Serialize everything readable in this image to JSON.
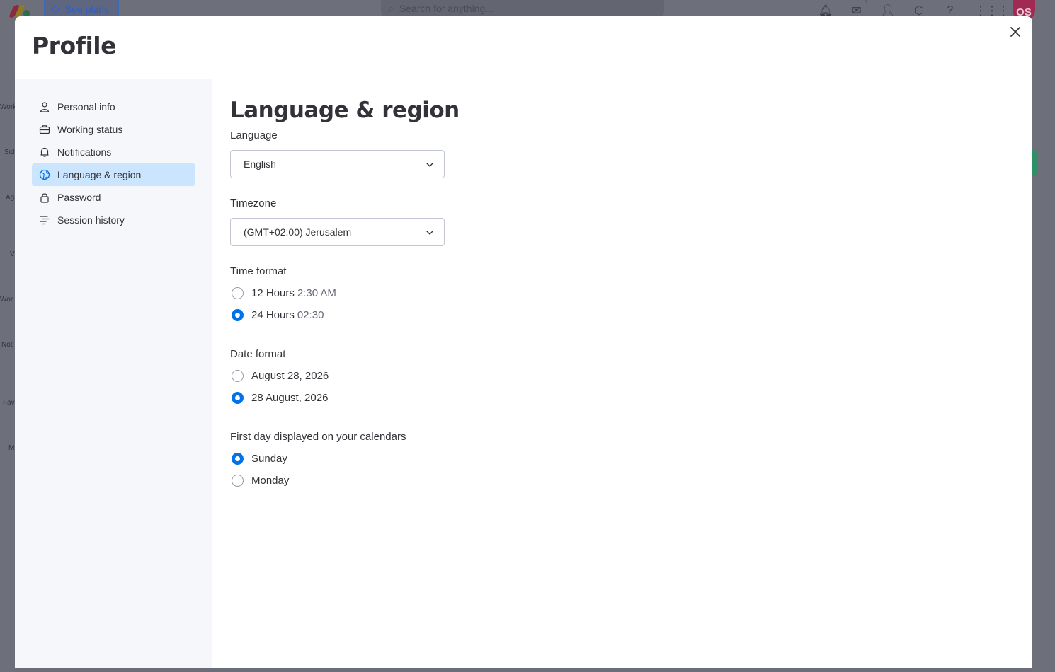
{
  "background": {
    "see_plans": "See plans",
    "search_placeholder": "Search for anything...",
    "inbox_count": "1",
    "avatar_initials": "OS",
    "left_labels": [
      "Work",
      "Sid",
      "Ag",
      "V",
      "Wor",
      "Not",
      "Fav",
      "M"
    ]
  },
  "modal": {
    "title": "Profile",
    "close_icon": "close-icon"
  },
  "sidebar": {
    "items": [
      {
        "label": "Personal info",
        "icon": "person-icon"
      },
      {
        "label": "Working status",
        "icon": "briefcase-icon"
      },
      {
        "label": "Notifications",
        "icon": "bell-icon"
      },
      {
        "label": "Language & region",
        "icon": "globe-icon",
        "active": true
      },
      {
        "label": "Password",
        "icon": "lock-icon"
      },
      {
        "label": "Session history",
        "icon": "list-icon"
      }
    ]
  },
  "content": {
    "title": "Language & region",
    "language": {
      "label": "Language",
      "value": "English"
    },
    "timezone": {
      "label": "Timezone",
      "value": "(GMT+02:00) Jerusalem"
    },
    "time_format": {
      "label": "Time format",
      "options": [
        {
          "label": "12 Hours",
          "example": "2:30 AM",
          "checked": false
        },
        {
          "label": "24 Hours",
          "example": "02:30",
          "checked": true
        }
      ]
    },
    "date_format": {
      "label": "Date format",
      "options": [
        {
          "label": "August 28, 2026",
          "checked": false
        },
        {
          "label": "28 August, 2026",
          "checked": true
        }
      ]
    },
    "first_day": {
      "label": "First day displayed on your calendars",
      "options": [
        {
          "label": "Sunday",
          "checked": true
        },
        {
          "label": "Monday",
          "checked": false
        }
      ]
    }
  },
  "colors": {
    "accent": "#0073ea",
    "active_nav_bg": "#cce5ff",
    "sidebar_bg": "#f6f7fb"
  }
}
